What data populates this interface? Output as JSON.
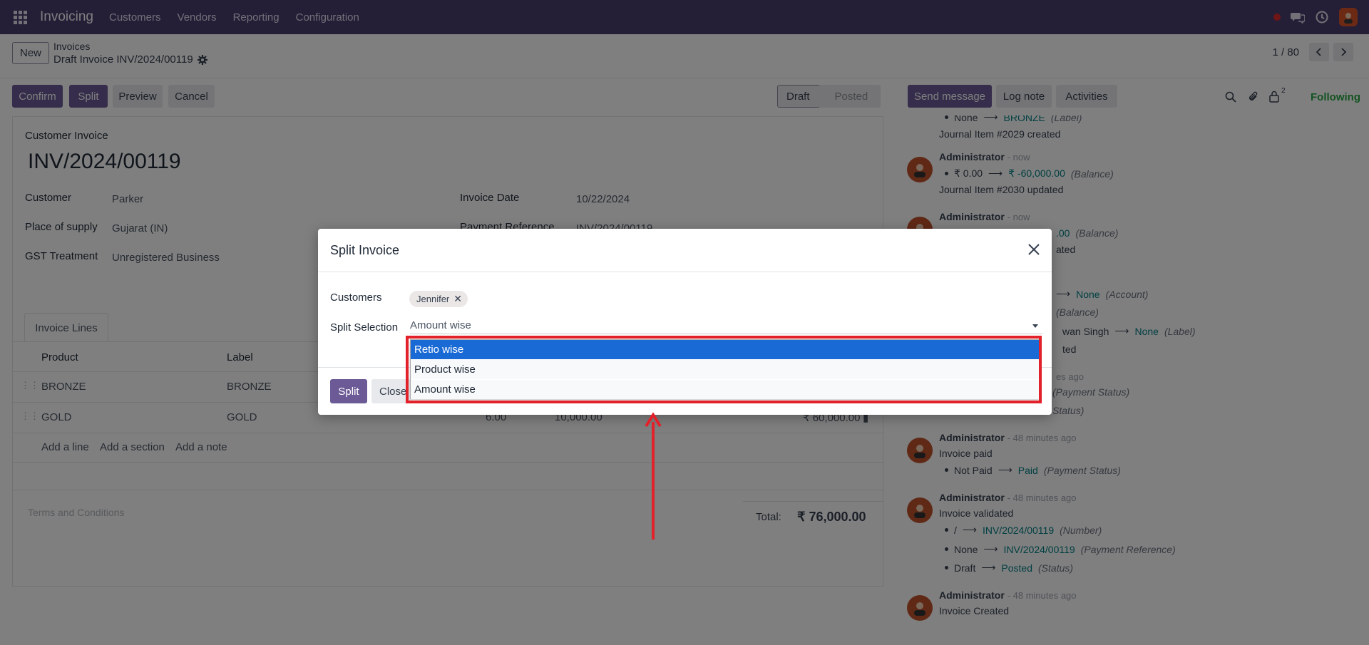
{
  "navbar": {
    "brand": "Invoicing",
    "menu": [
      "Customers",
      "Vendors",
      "Reporting",
      "Configuration"
    ]
  },
  "control_panel": {
    "new_label": "New",
    "breadcrumb_parent": "Invoices",
    "breadcrumb_current": "Draft Invoice INV/2024/00119",
    "pager": "1 / 80"
  },
  "actions": {
    "confirm": "Confirm",
    "split": "Split",
    "preview": "Preview",
    "cancel": "Cancel"
  },
  "statusbar": {
    "draft": "Draft",
    "posted": "Posted"
  },
  "form": {
    "type_label": "Customer Invoice",
    "number": "INV/2024/00119",
    "customer_label": "Customer",
    "customer_value": "Parker",
    "place_label": "Place of supply",
    "place_value": "Gujarat (IN)",
    "gst_label": "GST Treatment",
    "gst_value": "Unregistered Business",
    "invoice_date_label": "Invoice Date",
    "invoice_date_value": "10/22/2024",
    "payment_ref_label": "Payment Reference",
    "payment_ref_value": "INV/2024/00119",
    "tab_invoice_lines": "Invoice Lines",
    "col_product": "Product",
    "col_label": "Label",
    "lines": [
      {
        "product": "BRONZE",
        "label": "BRONZE",
        "qty": "",
        "price": "",
        "subtotal": ""
      },
      {
        "product": "GOLD",
        "label": "GOLD",
        "qty": "6.00",
        "price": "10,000.00",
        "subtotal": "₹ 60,000.00"
      }
    ],
    "add_line": "Add a line",
    "add_section": "Add a section",
    "add_note": "Add a note",
    "terms_placeholder": "Terms and Conditions",
    "total_label": "Total:",
    "total_value": "₹ 76,000.00"
  },
  "chatter": {
    "send_message": "Send message",
    "log_note": "Log note",
    "activities": "Activities",
    "follower_count": "2",
    "following": "Following",
    "messages": [
      {
        "lines": [
          "None",
          "BRONZE",
          "(Label)"
        ],
        "text": "Journal Item #2029 created"
      },
      {
        "author": "Administrator",
        "time": "- now",
        "old": "₹ 0.00",
        "new": "₹ -60,000.00",
        "field": "(Balance)",
        "text": "Journal Item #2030 updated"
      },
      {
        "author": "Administrator",
        "time": "- now",
        "new": ".00",
        "field": "(Balance)",
        "text": "ated"
      },
      {
        "new": "None",
        "field": "(Account)",
        "field2": "(Balance)",
        "old3": "wan Singh",
        "new3": "None",
        "field3": "(Label)",
        "text": "ted"
      },
      {
        "time": "es ago",
        "field": "(Payment Status)",
        "field2": "Status)"
      },
      {
        "author": "Administrator",
        "time": "- 48 minutes ago",
        "text": "Invoice paid",
        "old": "Not Paid",
        "new": "Paid",
        "field": "(Payment Status)"
      },
      {
        "author": "Administrator",
        "time": "- 48 minutes ago",
        "text": "Invoice validated",
        "changes": [
          {
            "old": "/",
            "new": "INV/2024/00119",
            "field": "(Number)"
          },
          {
            "old": "None",
            "new": "INV/2024/00119",
            "field": "(Payment Reference)"
          },
          {
            "old": "Draft",
            "new": "Posted",
            "field": "(Status)"
          }
        ]
      },
      {
        "author": "Administrator",
        "time": "- 48 minutes ago",
        "text": "Invoice Created"
      }
    ]
  },
  "modal": {
    "title": "Split Invoice",
    "customers_label": "Customers",
    "customer_tag": "Jennifer",
    "split_selection_label": "Split Selection",
    "split_selection_value": "Amount wise",
    "options": [
      "Retio wise",
      "Product wise",
      "Amount wise"
    ],
    "selected_option": "Retio wise",
    "split_button": "Split",
    "close_button": "Close"
  },
  "colors": {
    "navbar": "#4b3d6e",
    "primary": "#6b5a96",
    "link": "#017e84",
    "following": "#28a745",
    "annotation": "#e3212a",
    "selected_option": "#1a6ad6"
  }
}
